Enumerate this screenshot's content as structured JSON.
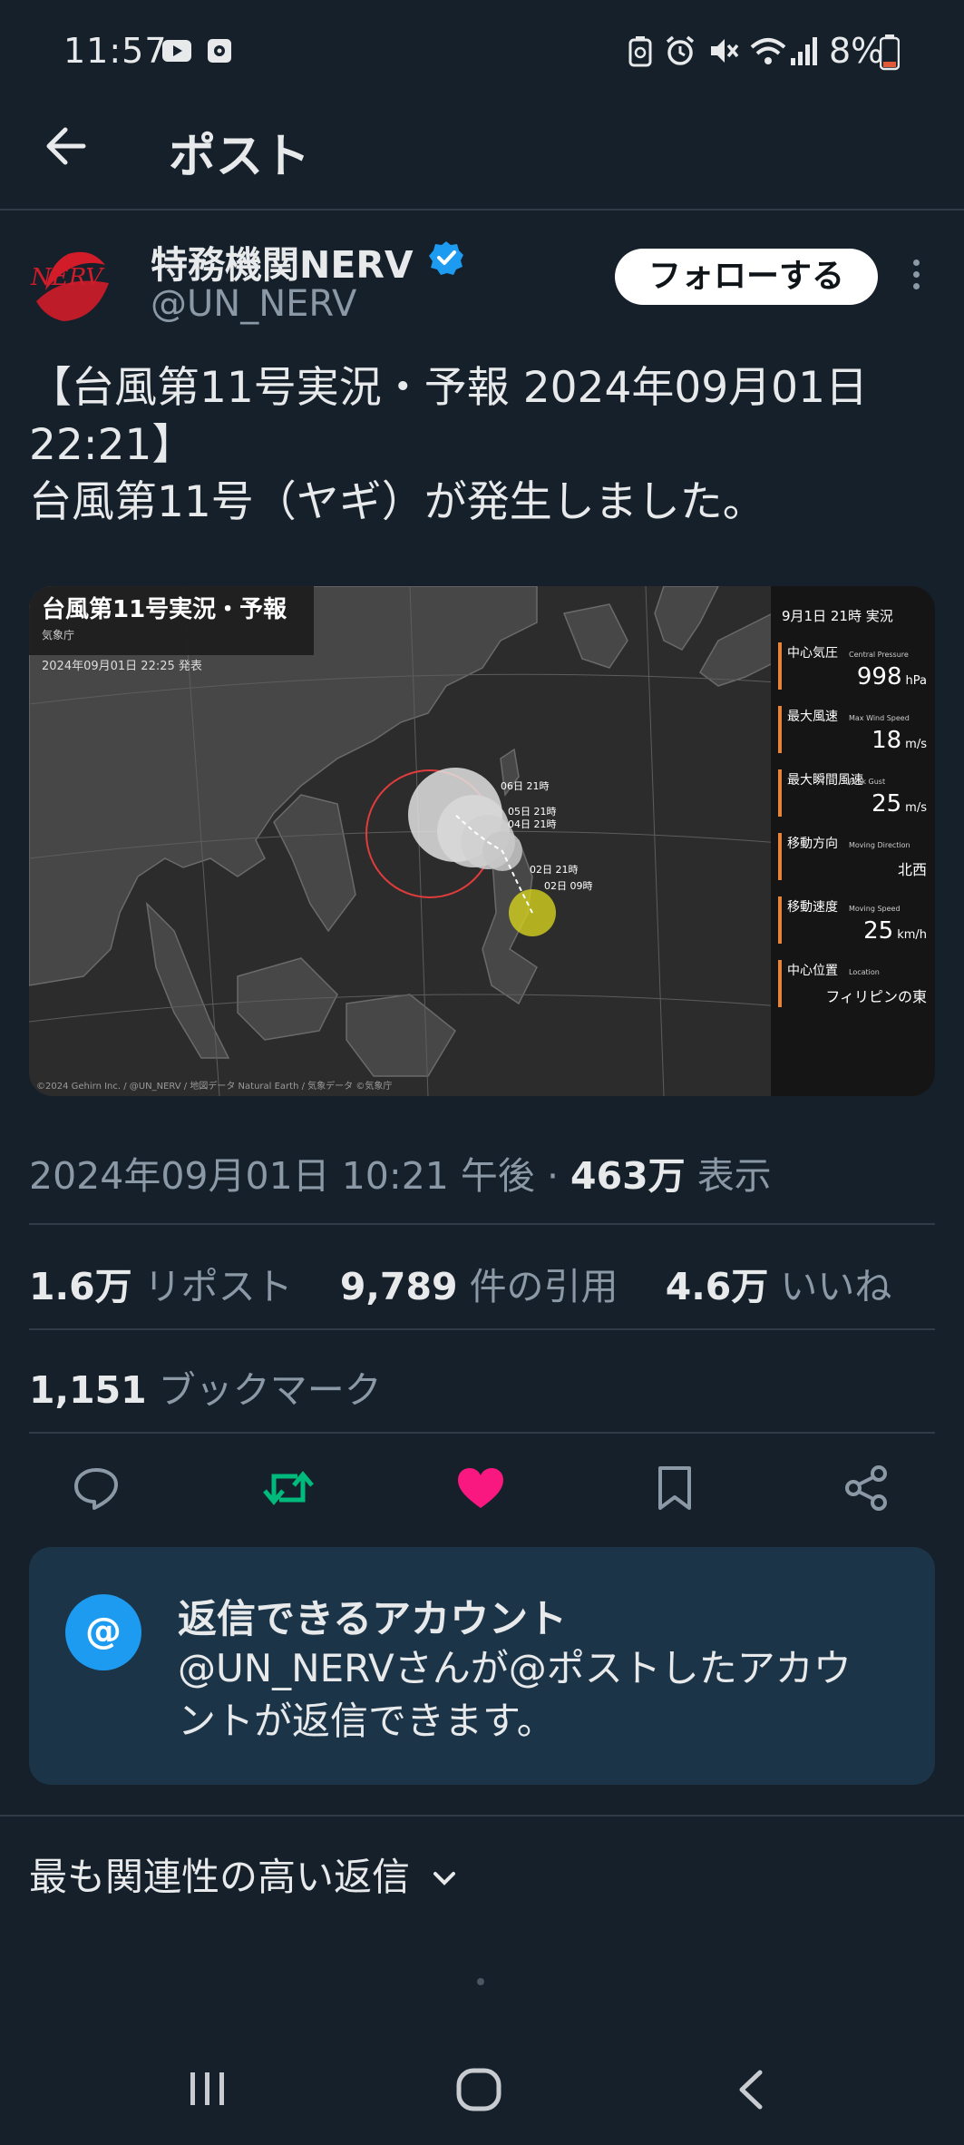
{
  "status_bar": {
    "time": "11:57",
    "battery": "8%",
    "icons": [
      "youtube-icon",
      "media-icon",
      "battery-saver-icon",
      "alarm-icon",
      "mute-icon",
      "wifi-icon",
      "signal-icon",
      "battery-icon"
    ]
  },
  "header": {
    "back_icon": "arrow-left-icon",
    "title": "ポスト"
  },
  "author": {
    "name": "特務機関NERV",
    "verified": true,
    "handle": "@UN_NERV",
    "follow_label": "フォローする",
    "avatar_text": "NERV"
  },
  "post": {
    "text_line1": "【台風第11号実況・予報 2024年09月01日",
    "text_line2": "22:21】",
    "text_line3": "台風第11号（ヤギ）が発生しました。"
  },
  "map": {
    "title": "台風第11号実況・予報",
    "agency": "気象庁",
    "issued": "2024年09月01日 22:25 発表",
    "panel_header": "9月1日 21時 実況",
    "rows": [
      {
        "jp": "中心気圧",
        "en": "Central Pressure",
        "value": "998",
        "unit": "hPa"
      },
      {
        "jp": "最大風速",
        "en": "Max Wind Speed",
        "value": "18",
        "unit": "m/s"
      },
      {
        "jp": "最大瞬間風速",
        "en": "Peak Gust",
        "value": "25",
        "unit": "m/s"
      },
      {
        "jp": "移動方向",
        "en": "Moving Direction",
        "value": "北西",
        "unit": ""
      },
      {
        "jp": "移動速度",
        "en": "Moving Speed",
        "value": "25",
        "unit": "km/h"
      },
      {
        "jp": "中心位置",
        "en": "Location",
        "value": "フィリピンの東",
        "unit": ""
      }
    ],
    "forecast_labels": [
      "06日 21時",
      "05日 21時",
      "04日 21時",
      "02日 21時",
      "02日 09時"
    ],
    "credit": "©2024 Gehirn Inc. / @UN_NERV / 地図データ Natural Earth / 気象データ ©気象庁",
    "colors": {
      "current": "#d4d21e",
      "forecast": "#e0e0e0",
      "storm_circle": "#e03c3c",
      "panel_accent": "#e8833a"
    }
  },
  "meta": {
    "datetime": "2024年09月01日 10:21 午後",
    "separator": "·",
    "views": "463万",
    "views_label": "表示"
  },
  "stats": {
    "reposts": "1.6万",
    "reposts_label": "リポスト",
    "quotes": "9,789",
    "quotes_label": "件の引用",
    "likes": "4.6万",
    "likes_label": "いいね",
    "bookmarks": "1,151",
    "bookmarks_label": "ブックマーク"
  },
  "actions": {
    "icons": [
      "reply-icon",
      "repost-icon",
      "like-icon",
      "bookmark-icon",
      "share-icon"
    ],
    "colors": {
      "repost": "#00ba7c",
      "like": "#f91880",
      "default": "#8b98a5"
    }
  },
  "reply_restriction": {
    "icon": "@",
    "title": "返信できるアカウント",
    "body_line1": "@UN_NERVさんが@ポストしたアカウ",
    "body_line2": "ントが返信できます。"
  },
  "replies": {
    "sort_label": "最も関連性の高い返信"
  },
  "navbar": {
    "icons": [
      "recent-apps-icon",
      "home-icon",
      "back-icon"
    ]
  }
}
